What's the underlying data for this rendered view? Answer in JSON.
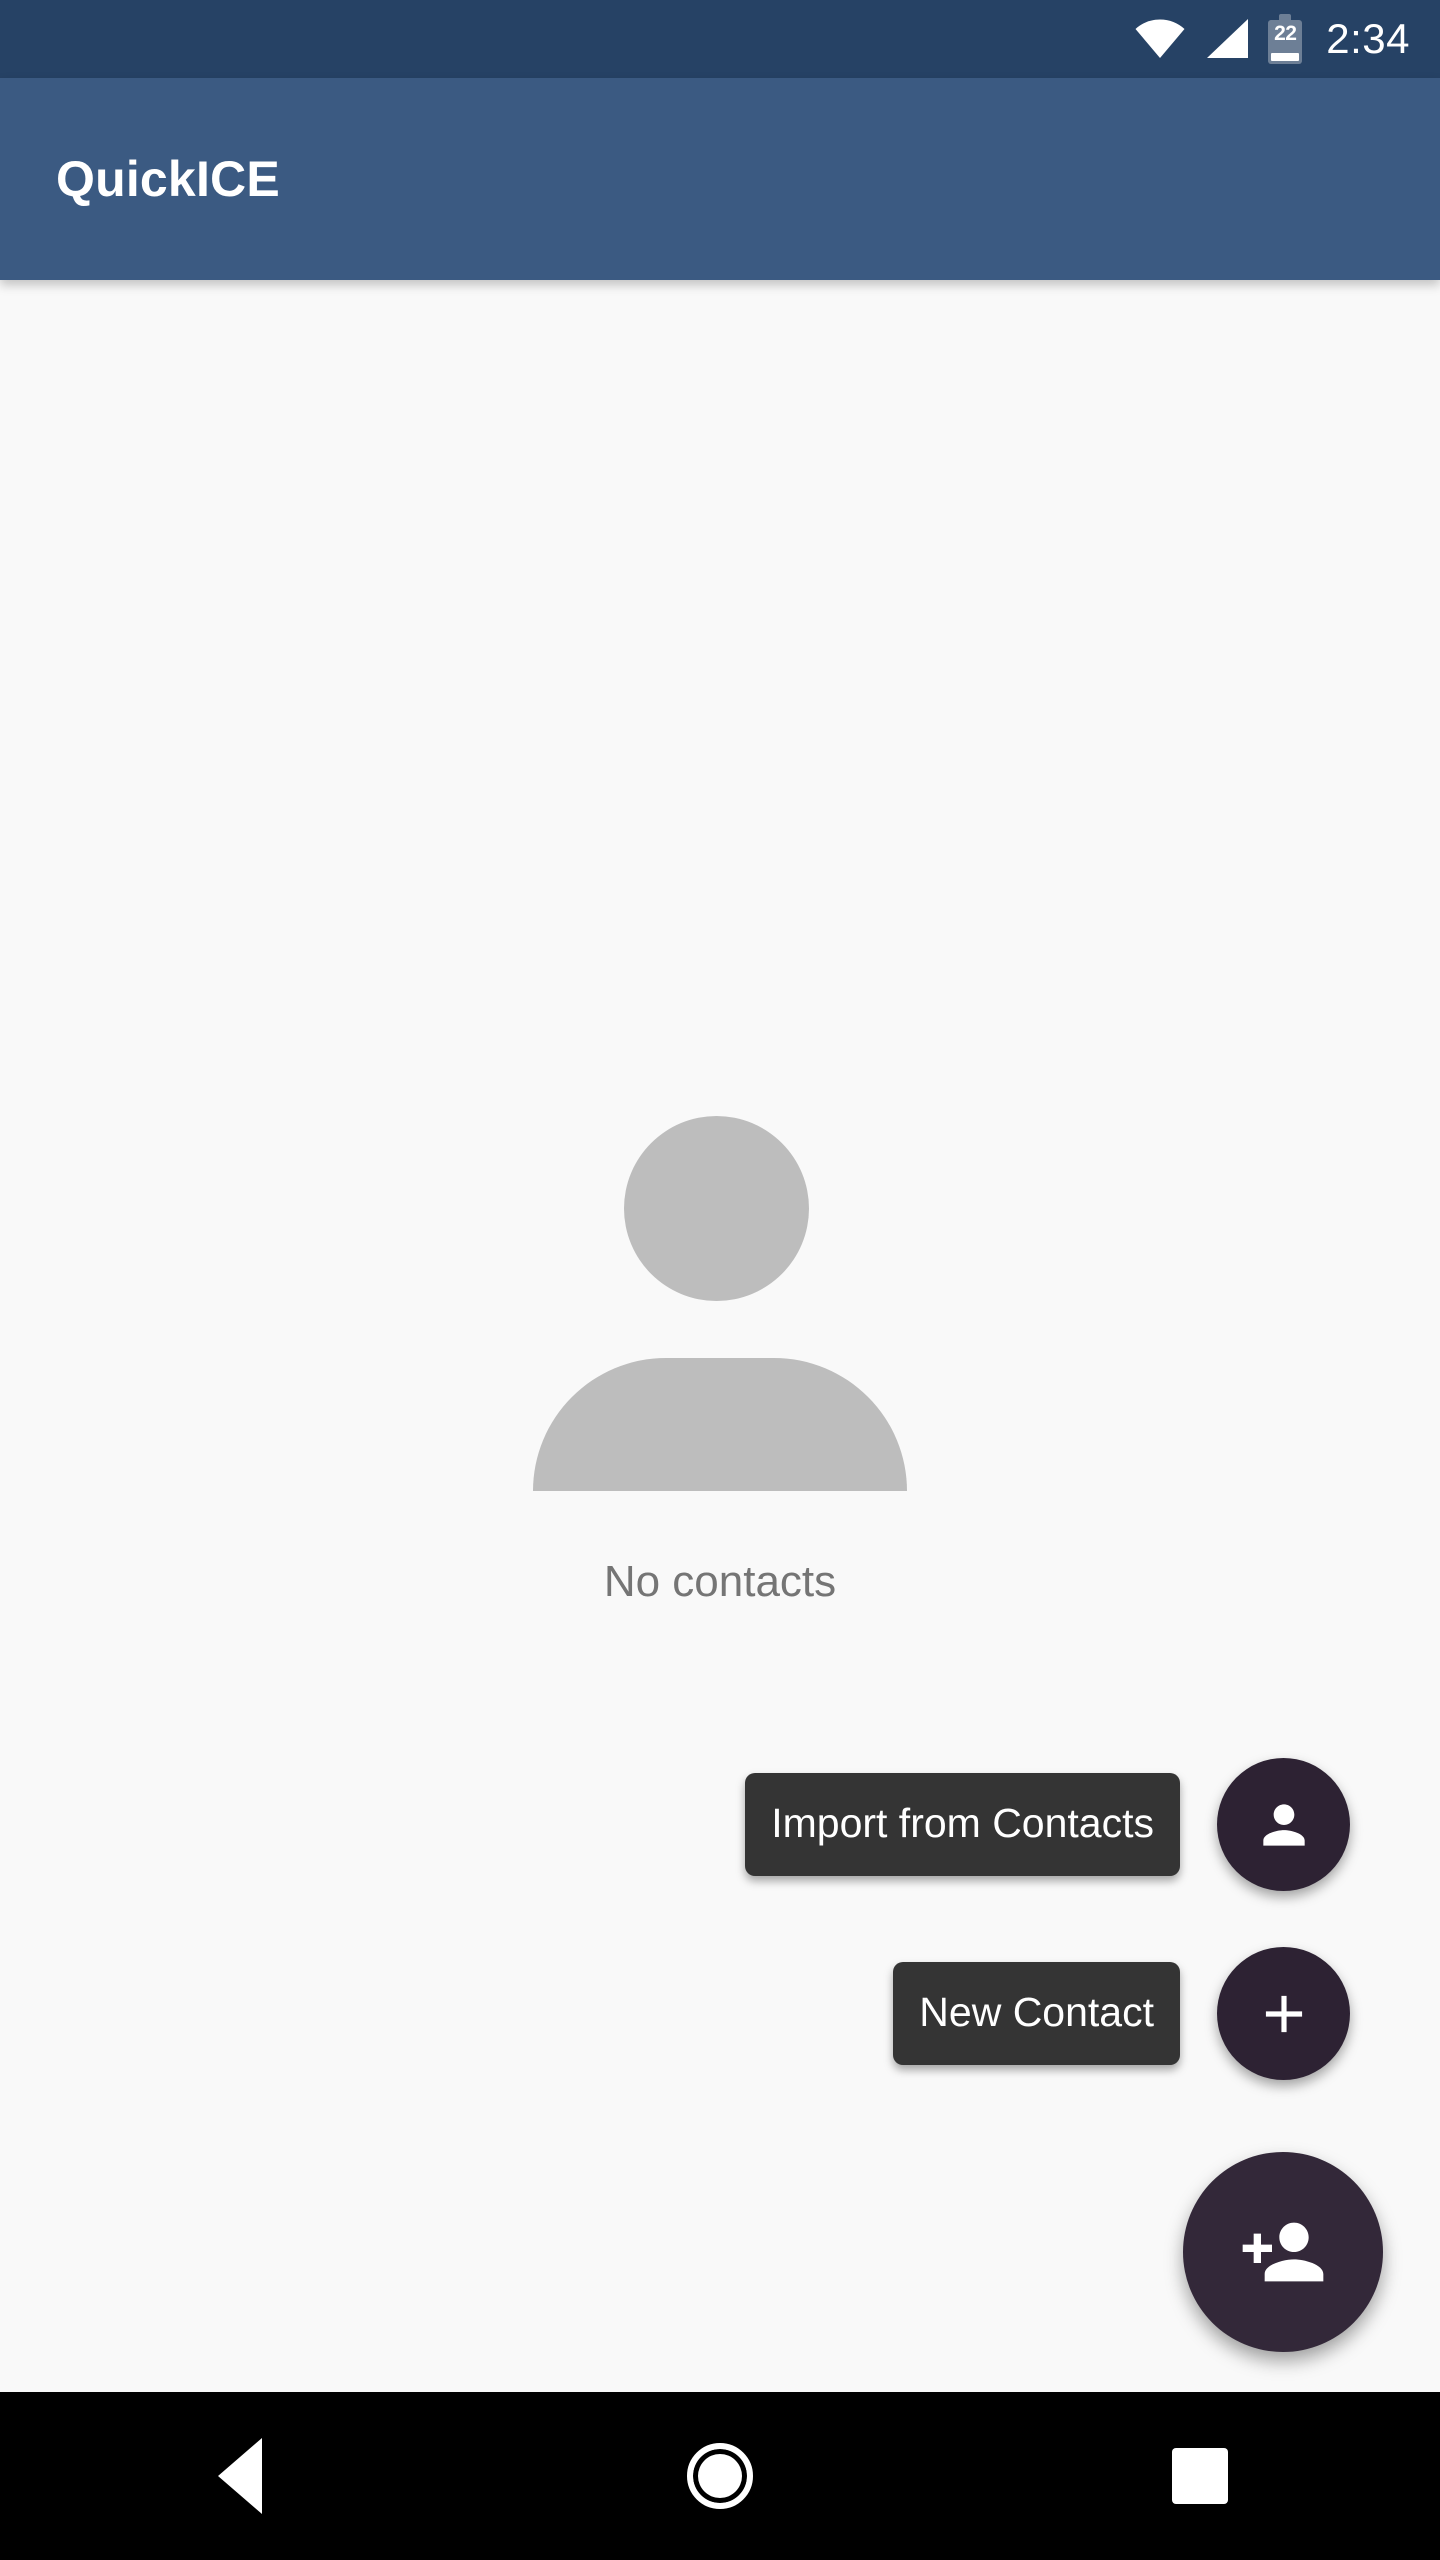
{
  "status_bar": {
    "time": "2:34",
    "battery_level": "22",
    "icons": [
      "wifi-icon",
      "cellular-signal-icon",
      "battery-icon"
    ],
    "background_color": "#264265"
  },
  "app_bar": {
    "title": "QuickICE",
    "background_color": "#3b5a82",
    "title_color": "#ffffff"
  },
  "content": {
    "background_color": "#f9f9f9",
    "empty_state": {
      "icon": "person-placeholder-icon",
      "icon_color": "#bdbdbd",
      "message": "No contacts",
      "message_color": "#757575"
    }
  },
  "speed_dial": {
    "fab_color": "#2d2233",
    "main_fab_color": "#332839",
    "label_background_color": "#343434",
    "label_text_color": "#ffffff",
    "main_fab": {
      "icon": "person-add-icon",
      "label": ""
    },
    "actions": [
      {
        "label": "Import from Contacts",
        "icon": "person-icon"
      },
      {
        "label": "New Contact",
        "icon": "plus-icon"
      }
    ]
  },
  "nav_bar": {
    "background_color": "#000000",
    "buttons": [
      {
        "name": "back",
        "icon": "triangle-back-icon"
      },
      {
        "name": "home",
        "icon": "circle-home-icon"
      },
      {
        "name": "recents",
        "icon": "square-recents-icon"
      }
    ]
  }
}
